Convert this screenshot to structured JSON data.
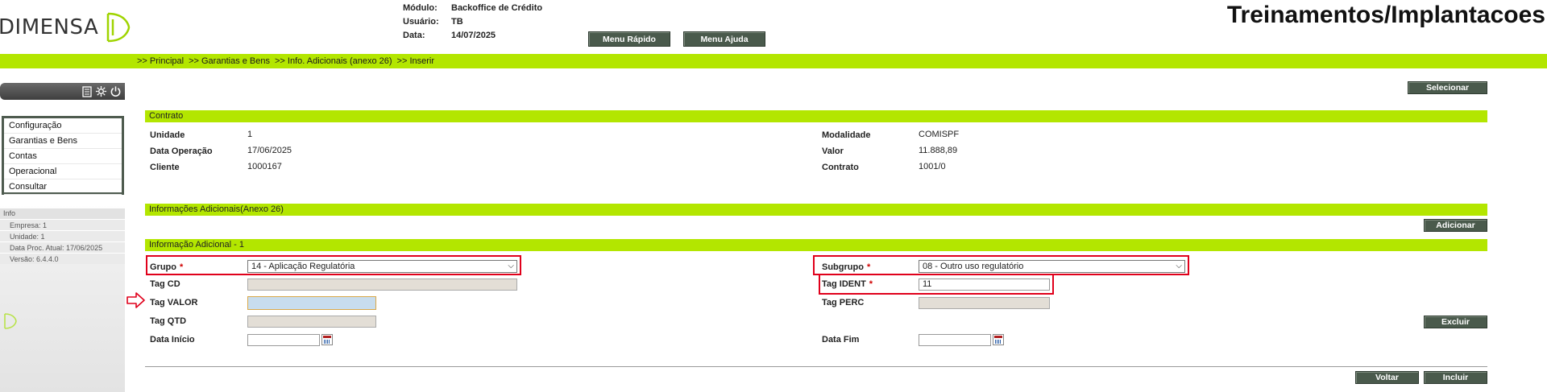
{
  "header": {
    "logo_text": "DIMENSA",
    "meta": [
      {
        "label": "Módulo:",
        "value": "Backoffice de Crédito"
      },
      {
        "label": "Usuário:",
        "value": "TB"
      },
      {
        "label": "Data:",
        "value": "14/07/2025"
      }
    ],
    "menu_rapido": "Menu Rápido",
    "menu_ajuda": "Menu Ajuda",
    "company": "Treinamentos/Implantacoes"
  },
  "breadcrumb": [
    ">> Principal",
    ">> Garantias e Bens",
    ">> Info. Adicionais (anexo 26)",
    ">> Inserir"
  ],
  "sidebar": {
    "menu": [
      "Configuração",
      "Garantias e Bens",
      "Contas",
      "Operacional",
      "Consultar"
    ],
    "info_title": "Info",
    "info_lines": [
      "Empresa: 1",
      "Unidade: 1",
      "Data Proc. Atual: 17/06/2025",
      "Versão: 6.4.4.0"
    ]
  },
  "actions": {
    "selecionar": "Selecionar",
    "adicionar": "Adicionar",
    "excluir": "Excluir",
    "voltar": "Voltar",
    "incluir": "Incluir"
  },
  "contrato": {
    "title": "Contrato",
    "unidade_label": "Unidade",
    "unidade": "1",
    "data_operacao_label": "Data Operação",
    "data_operacao": "17/06/2025",
    "cliente_label": "Cliente",
    "cliente": "1000167",
    "modalidade_label": "Modalidade",
    "modalidade": "COMISPF",
    "valor_label": "Valor",
    "valor": "11.888,89",
    "contrato_label": "Contrato",
    "contrato": "1001/0"
  },
  "info_adicionais_title": "Informações Adicionais(Anexo 26)",
  "info_adicional": {
    "title": "Informação Adicional - 1",
    "grupo_label": "Grupo",
    "grupo_value": "14 - Aplicação Regulatória",
    "subgrupo_label": "Subgrupo",
    "subgrupo_value": "08 - Outro uso regulatório",
    "tag_cd_label": "Tag CD",
    "tag_ident_label": "Tag IDENT",
    "tag_ident_value": "11",
    "tag_valor_label": "Tag VALOR",
    "tag_perc_label": "Tag PERC",
    "tag_qtd_label": "Tag QTD",
    "data_inicio_label": "Data Início",
    "data_fim_label": "Data Fim",
    "required_mark": "*"
  },
  "colors": {
    "accent_bar": "#b3e600",
    "button": "#4a5a4c",
    "highlight": "#e0001b"
  }
}
